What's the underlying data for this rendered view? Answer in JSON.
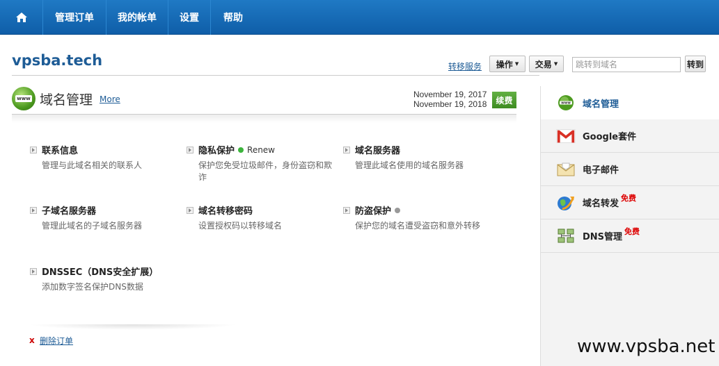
{
  "nav": {
    "home_icon": "home-icon",
    "items": [
      "管理订单",
      "我的帐单",
      "设置",
      "帮助"
    ]
  },
  "header": {
    "site": "vpsba.tech",
    "transfer_link": "转移服务",
    "ops_button": "操作",
    "trade_button": "交易",
    "goto_placeholder": "跳转到域名",
    "goto_button": "转到"
  },
  "section": {
    "title": "域名管理",
    "more": "More",
    "date_start": "November 19, 2017",
    "date_end": "November 19, 2018",
    "renew_button": "续费"
  },
  "features": [
    {
      "title": "联系信息",
      "desc": "管理与此域名相关的联系人"
    },
    {
      "title": "隐私保护",
      "status": "Renew",
      "status_color": "#3cb43c",
      "desc": "保护您免受垃圾邮件，身份盗窃和欺诈"
    },
    {
      "title": "域名服务器",
      "desc": "管理此域名使用的域名服务器"
    },
    {
      "title": "子域名服务器",
      "desc": "管理此域名的子域名服务器"
    },
    {
      "title": "域名转移密码",
      "desc": "设置授权码以转移域名"
    },
    {
      "title": "防盗保护",
      "status_color": "#999999",
      "desc": "保护您的域名遭受盗窃和意外转移"
    },
    {
      "title": "DNSSEC（DNS安全扩展）",
      "desc": "添加数字签名保护DNS数据"
    }
  ],
  "delete": {
    "x": "x",
    "label": "删除订单"
  },
  "sidebar": {
    "items": [
      {
        "label": "域名管理",
        "icon": "www-globe-icon",
        "active": true
      },
      {
        "label": "Google套件",
        "icon": "gmail-icon"
      },
      {
        "label": "电子邮件",
        "icon": "envelope-icon"
      },
      {
        "label": "域名转发",
        "icon": "forward-globe-icon",
        "badge": "免费"
      },
      {
        "label": "DNS管理",
        "icon": "dns-server-icon",
        "badge": "免费"
      }
    ]
  },
  "watermark": "www.vpsba.net",
  "colors": {
    "nav_blue": "#1f79c4",
    "link_blue": "#1e5c96",
    "green_button": "#3d8c21",
    "free_red": "#d00000"
  }
}
